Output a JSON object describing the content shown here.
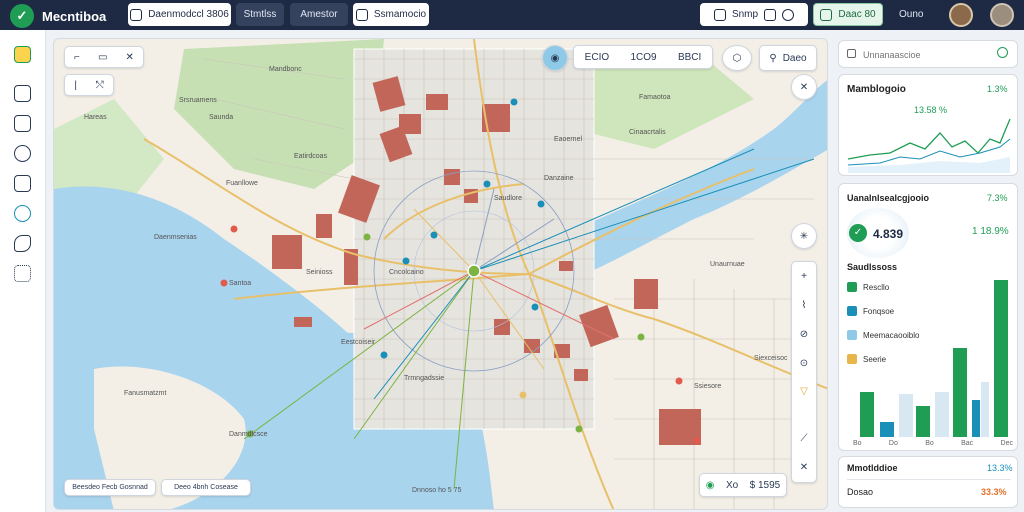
{
  "header": {
    "app_name": "Mecntiboa",
    "pills": [
      "Daenmodccl 3806",
      "Stmtlss",
      "Amestor",
      "Ssmamocio"
    ],
    "search_label": "Snmp",
    "status_label": "Daac 80",
    "user_label": "Ouno"
  },
  "map": {
    "search_value": "",
    "zoom_chips": [
      "ECIO",
      "1CO9",
      "BBCI"
    ],
    "layer_label": "Daeo",
    "labels": [
      "Mandbonc",
      "Saunda",
      "Srsruamens",
      "Hareas",
      "Fuanllowe",
      "Eatirdcoas",
      "Daenmsenias",
      "Seinioss",
      "Cinaacrtalis",
      "Famaotoa",
      "Eestcoiseir",
      "Unaurnuae",
      "Siexceisoc",
      "Ssiesore",
      "Trmngadssie",
      "Danmdlcsce",
      "Fanusmatzmt",
      "Saudlore",
      "Eaoernel",
      "Santoa",
      "Cncolcaino",
      "Danzaine"
    ],
    "scale_left": "Beesdeo Fecb Gosnnad",
    "scale_mid": "Deeo 4bnh Cosease",
    "scale_bottom": "Dnnoso ho 5 75",
    "footer_chip_a": "Xo",
    "footer_chip_b": "$ 1595"
  },
  "search_panel": {
    "placeholder": "Unnanaascioe"
  },
  "trend_panel": {
    "title": "Mamblogoio",
    "value_a": "13.58 %",
    "value_b": "1.3%"
  },
  "stats_panel": {
    "title": "Uanalnlsealcgjooio",
    "title_value": "7.3%",
    "big_value": "4.839",
    "big_change": "1 18.9%",
    "legend_title": "Saudlssoss",
    "legend": [
      {
        "label": "Rescllo",
        "color": "#1f9d55"
      },
      {
        "label": "Fonqsoe",
        "color": "#1a8fb8"
      },
      {
        "label": "Meemacaooiblo",
        "color": "#8ec9e8"
      },
      {
        "label": "Seerie",
        "color": "#e8b54a"
      }
    ],
    "bar_labels": [
      "Bo",
      "Do",
      "Bo",
      "Bac",
      "Dec"
    ]
  },
  "bottom_panel": {
    "row1_label": "Mmotlddioe",
    "row1_value": "13.3%",
    "row2_label": "Dosao",
    "row2_value": "33.3%"
  },
  "colors": {
    "accent": "#1f9d55",
    "blue": "#1a8fb8",
    "header": "#1e2a44",
    "water": "#a9d4ee",
    "park": "#c6e0b4"
  },
  "icons": [
    "logo-icon",
    "search-icon",
    "layers-icon",
    "location-icon",
    "compass-icon",
    "zoom-in-icon",
    "zoom-out-icon",
    "route-icon",
    "pin-icon"
  ]
}
